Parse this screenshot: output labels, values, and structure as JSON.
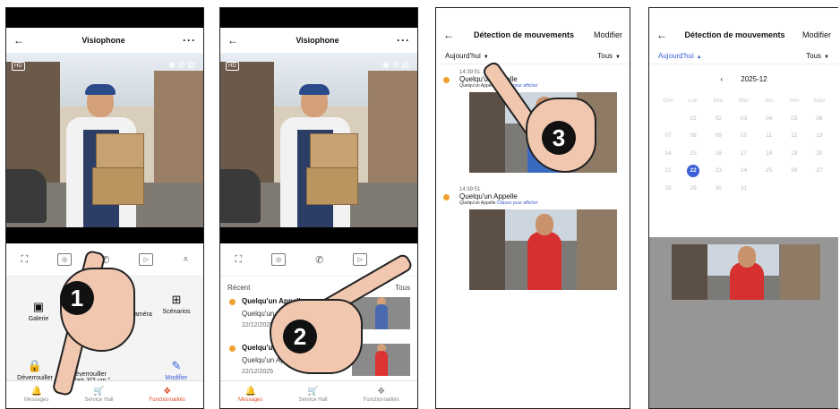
{
  "panel1": {
    "title": "Visiophone",
    "video_badge": "HD",
    "tiles": [
      "Galerie",
      "Coupure Caméra",
      "Scénarios",
      "Déverrouiller Relais 1",
      "Déverrouiller Relais 3/\"Lum.\"",
      "Modifier"
    ],
    "nav": [
      "Messages",
      "Service Hall",
      "Fonctionnalités"
    ]
  },
  "panel2": {
    "title": "Visiophone",
    "video_badge": "HD",
    "recent_label": "Récent",
    "all_label": "Tous",
    "items": [
      {
        "title": "Quelqu'un Appelle",
        "sub": "Quelqu'un Appelle",
        "date": "22/12/2025"
      },
      {
        "title": "Quelqu'un Appelle",
        "sub": "Quelqu'un Appelle",
        "date": "22/12/2025"
      }
    ],
    "nav": [
      "Messages",
      "Service Hall",
      "Fonctionnalités"
    ]
  },
  "panel3": {
    "title": "Détection de mouvements",
    "edit": "Modifier",
    "filter_today": "Aujourd'hui",
    "filter_all": "Tous",
    "events": [
      {
        "time": "14:39:51",
        "title": "Quelqu'un Appelle",
        "sub": "Quelqu'un Appelle",
        "link": "Cliquez pour afficher"
      },
      {
        "time": "14:39:51",
        "title": "Quelqu'un Appelle",
        "sub": "Quelqu'un Appelle",
        "link": "Cliquez pour afficher"
      }
    ]
  },
  "panel4": {
    "title": "Détection de mouvements",
    "edit": "Modifier",
    "filter_today": "Aujourd'hui",
    "filter_all": "Tous",
    "month": "2025-12",
    "weekdays": [
      "Dim",
      "Lun",
      "Mar",
      "Mer",
      "Jeu",
      "Ven",
      "Sam"
    ],
    "selected_day": "22"
  },
  "steps": [
    "1",
    "2",
    "3"
  ],
  "colors": {
    "accent_orange": "#e0502a",
    "accent_blue": "#3b5fd6",
    "dot_orange": "#f0a030"
  }
}
